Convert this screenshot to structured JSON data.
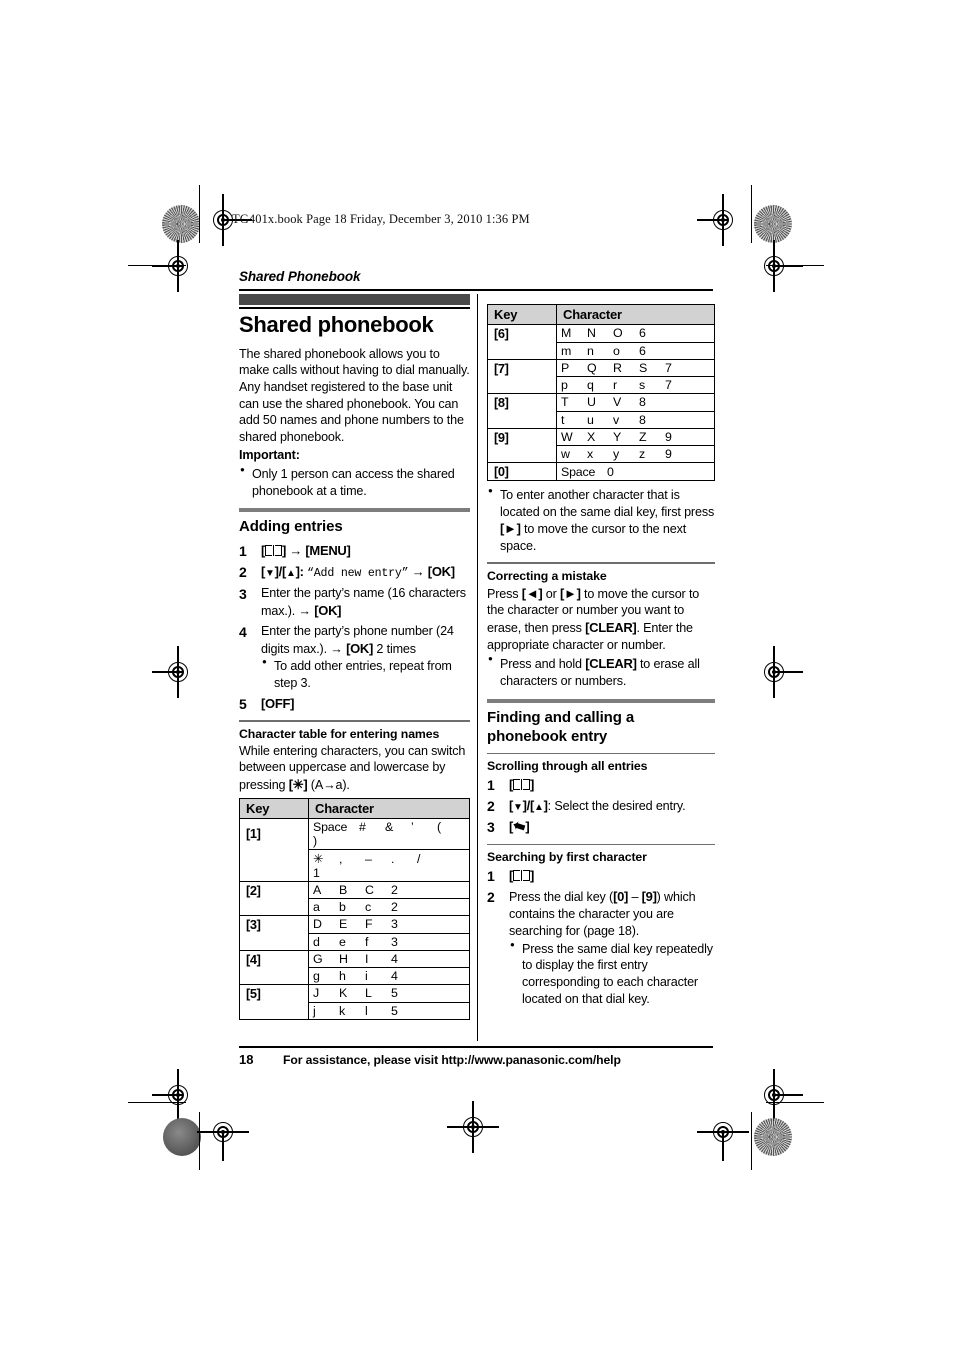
{
  "file_stamp": "TG401x.book  Page 18  Friday, December 3, 2010  1:36 PM",
  "running_header": "Shared Phonebook",
  "left_column": {
    "title": "Shared phonebook",
    "intro": "The shared phonebook allows you to make calls without having to dial manually. Any handset registered to the base unit can use the shared phonebook. You can add 50 names and phone numbers to the shared phonebook.",
    "important_label": "Important:",
    "important_bullets": [
      "Only 1 person can access the shared phonebook at a time."
    ],
    "adding_entries": {
      "heading": "Adding entries",
      "steps": [
        {
          "icon": "phonebook-icon",
          "text_before": "[",
          "text_after": "] → [MENU]"
        },
        {
          "text": "[▼]/[▲]: “Add new entry” → [OK]"
        },
        {
          "text": "Enter the party’s name (16 characters max.). → [OK]"
        },
        {
          "text": "Enter the party’s phone number (24 digits max.). → [OK] 2 times",
          "sub_bullets": [
            "To add other entries, repeat from step 3."
          ]
        },
        {
          "text": "[OFF]"
        }
      ]
    },
    "char_table_section": {
      "heading": "Character table for entering names",
      "body": "While entering characters, you can switch between uppercase and lowercase by pressing [✳] (A→a)."
    },
    "table": {
      "headers": [
        "Key",
        "Character"
      ],
      "rows": [
        {
          "key": "[1]",
          "lines": [
            [
              "Space",
              "#",
              "&",
              "’",
              "(",
              ")"
            ],
            [
              "✳",
              ",",
              "–",
              ".",
              "/",
              "1"
            ]
          ]
        },
        {
          "key": "[2]",
          "lines": [
            [
              "A",
              "B",
              "C",
              "2"
            ],
            [
              "a",
              "b",
              "c",
              "2"
            ]
          ]
        },
        {
          "key": "[3]",
          "lines": [
            [
              "D",
              "E",
              "F",
              "3"
            ],
            [
              "d",
              "e",
              "f",
              "3"
            ]
          ]
        },
        {
          "key": "[4]",
          "lines": [
            [
              "G",
              "H",
              "I",
              "4"
            ],
            [
              "g",
              "h",
              "i",
              "4"
            ]
          ]
        },
        {
          "key": "[5]",
          "lines": [
            [
              "J",
              "K",
              "L",
              "5"
            ],
            [
              "j",
              "k",
              "l",
              "5"
            ]
          ]
        }
      ]
    }
  },
  "right_column": {
    "table": {
      "headers": [
        "Key",
        "Character"
      ],
      "rows": [
        {
          "key": "[6]",
          "lines": [
            [
              "M",
              "N",
              "O",
              "6"
            ],
            [
              "m",
              "n",
              "o",
              "6"
            ]
          ]
        },
        {
          "key": "[7]",
          "lines": [
            [
              "P",
              "Q",
              "R",
              "S",
              "7"
            ],
            [
              "p",
              "q",
              "r",
              "s",
              "7"
            ]
          ]
        },
        {
          "key": "[8]",
          "lines": [
            [
              "T",
              "U",
              "V",
              "8"
            ],
            [
              "t",
              "u",
              "v",
              "8"
            ]
          ]
        },
        {
          "key": "[9]",
          "lines": [
            [
              "W",
              "X",
              "Y",
              "Z",
              "9"
            ],
            [
              "w",
              "x",
              "y",
              "z",
              "9"
            ]
          ]
        },
        {
          "key": "[0]",
          "lines": [
            [
              "Space",
              "0"
            ]
          ]
        }
      ]
    },
    "after_table_bullets": [
      "To enter another character that is located on the same dial key, first press [►] to move the cursor to the next space."
    ],
    "correcting": {
      "heading": "Correcting a mistake",
      "body": "Press [◄] or [►] to move the cursor to the character or number you want to erase, then press [CLEAR]. Enter the appropriate character or number.",
      "bullets": [
        "Press and hold [CLEAR] to erase all characters or numbers."
      ]
    },
    "finding": {
      "heading": "Finding and calling a phonebook entry",
      "scrolling": {
        "heading": "Scrolling through all entries",
        "steps": [
          {
            "icon": "phonebook-icon",
            "text": "[ ]"
          },
          {
            "text": "[▼]/[▲]: Select the desired entry."
          },
          {
            "icon": "talk-icon",
            "text": "[ ]"
          }
        ]
      },
      "searching": {
        "heading": "Searching by first character",
        "steps": [
          {
            "icon": "phonebook-icon",
            "text": "[ ]"
          },
          {
            "text": "Press the dial key ([0] – [9]) which contains the character you are searching for (page 18).",
            "sub_bullets": [
              "Press the same dial key repeatedly to display the first entry corresponding to each character located on that dial key."
            ]
          }
        ]
      }
    }
  },
  "footer": {
    "page_number": "18",
    "note": "For assistance, please visit http://www.panasonic.com/help"
  }
}
